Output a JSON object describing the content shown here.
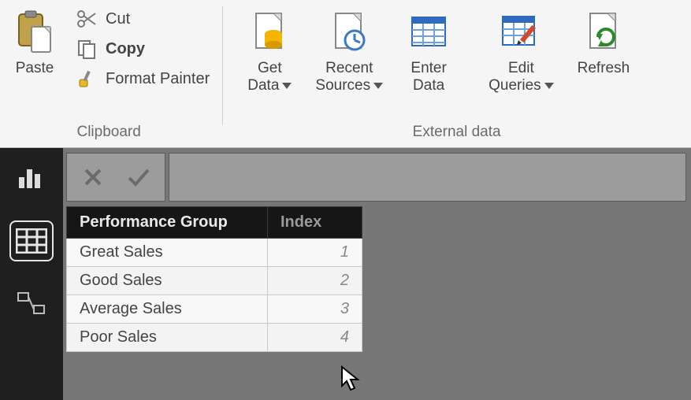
{
  "ribbon": {
    "paste": {
      "label": "Paste"
    },
    "cut": {
      "label": "Cut"
    },
    "copy": {
      "label": "Copy"
    },
    "format_painter": {
      "label": "Format Painter"
    },
    "clipboard_group": "Clipboard",
    "get_data": {
      "label": "Get\nData"
    },
    "recent_sources": {
      "label": "Recent\nSources"
    },
    "enter_data": {
      "label": "Enter\nData"
    },
    "edit_queries": {
      "label": "Edit\nQueries"
    },
    "refresh": {
      "label": "Refresh"
    },
    "external_data_group": "External data"
  },
  "table": {
    "headers": {
      "group": "Performance Group",
      "index": "Index"
    },
    "rows": [
      {
        "name": "Great Sales",
        "index": "1"
      },
      {
        "name": "Good Sales",
        "index": "2"
      },
      {
        "name": "Average Sales",
        "index": "3"
      },
      {
        "name": "Poor Sales",
        "index": "4"
      }
    ]
  }
}
